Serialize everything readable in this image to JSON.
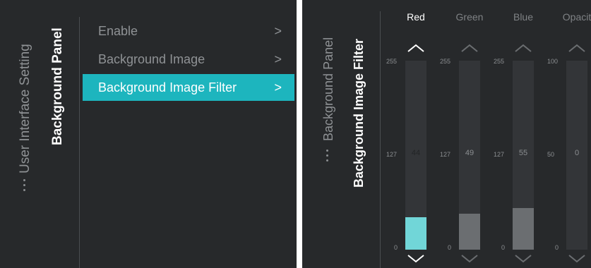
{
  "left": {
    "breadcrumb_parent": "User Interface Setting",
    "breadcrumb_current": "Background Panel",
    "menu": [
      {
        "label": "Enable",
        "chevron": ">"
      },
      {
        "label": "Background Image",
        "chevron": ">"
      },
      {
        "label": "Background Image Filter",
        "chevron": ">",
        "selected": true
      }
    ]
  },
  "right": {
    "breadcrumb_parent": "Background Panel",
    "breadcrumb_current": "Background Image Filter",
    "sliders": [
      {
        "title": "Red",
        "max": "255",
        "mid": "127",
        "min": "0",
        "value": "44",
        "level": 0.17,
        "active": true
      },
      {
        "title": "Green",
        "max": "255",
        "mid": "127",
        "min": "0",
        "value": "49",
        "level": 0.19,
        "active": false
      },
      {
        "title": "Blue",
        "max": "255",
        "mid": "127",
        "min": "0",
        "value": "55",
        "level": 0.22,
        "active": false
      },
      {
        "title": "Opacit",
        "max": "100",
        "mid": "50",
        "min": "0",
        "value": "0",
        "level": 0.0,
        "active": false
      }
    ]
  },
  "colors": {
    "panel_bg": "#27292b",
    "accent": "#1db5be",
    "active_fill": "#71d6d8",
    "inactive_fill": "#6b6e71"
  },
  "icons": [
    "more-dots-icon",
    "chevron-right-icon",
    "chevron-up-icon",
    "chevron-down-icon"
  ]
}
